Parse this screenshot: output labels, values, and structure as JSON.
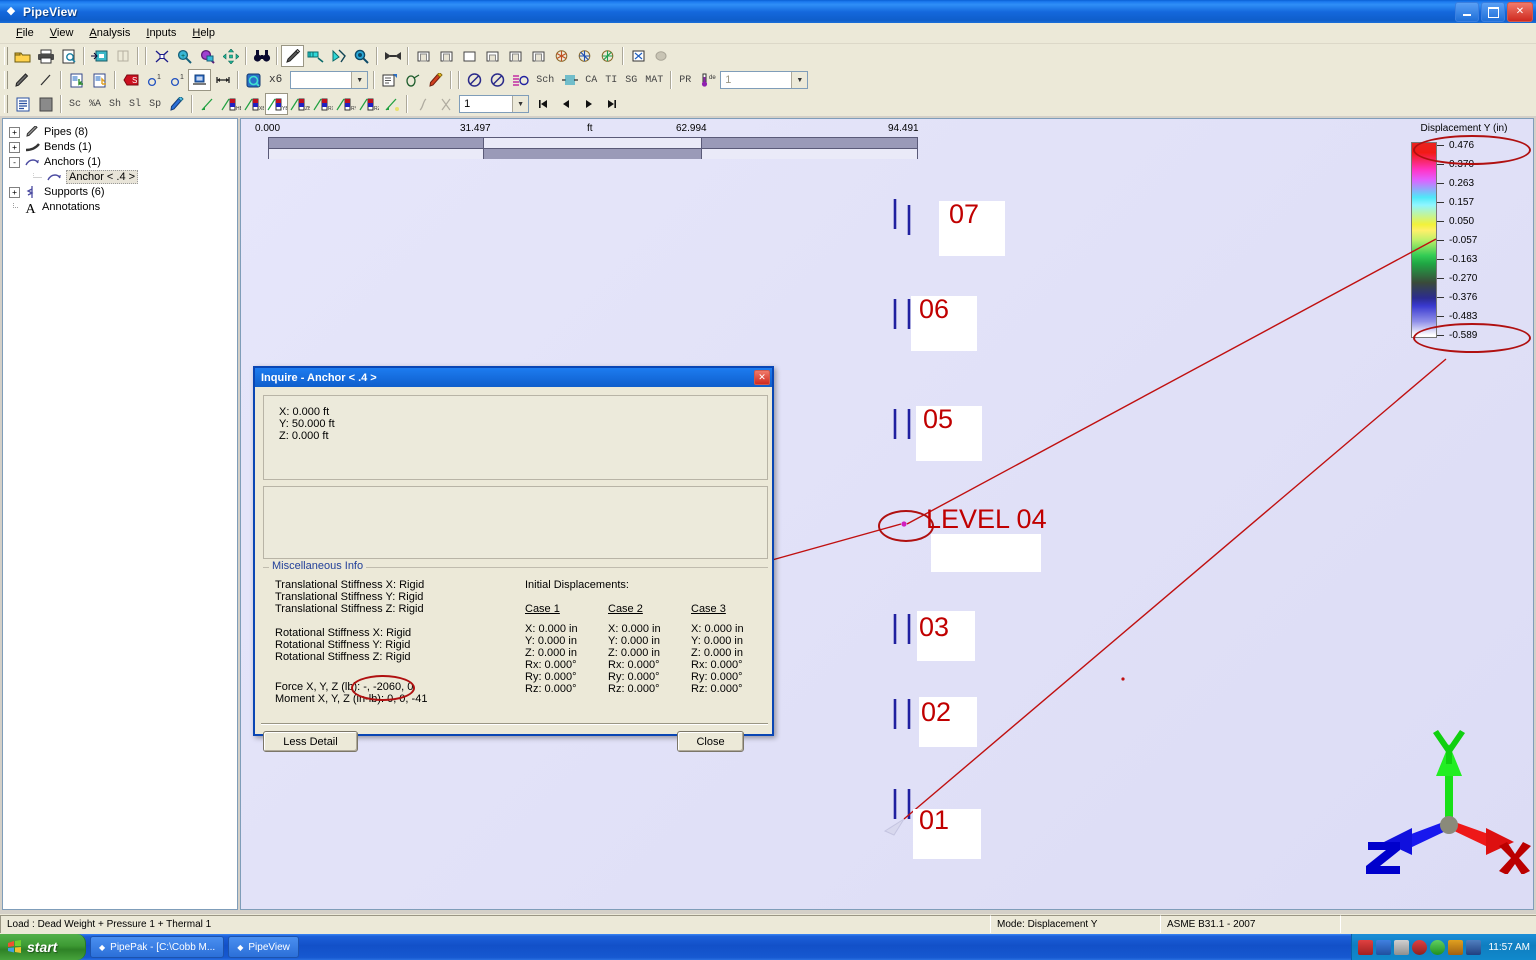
{
  "window": {
    "title": "PipeView",
    "icon": "diamond-icon",
    "buttons": {
      "minimize": "–",
      "maximize": "❐",
      "close": "✕"
    }
  },
  "menu": {
    "items": [
      {
        "label": "File",
        "name": "menu-file"
      },
      {
        "label": "View",
        "name": "menu-view"
      },
      {
        "label": "Analysis",
        "name": "menu-analysis"
      },
      {
        "label": "Inputs",
        "name": "menu-inputs"
      },
      {
        "label": "Help",
        "name": "menu-help"
      }
    ]
  },
  "toolbar_row3": {
    "labels": [
      "Sc",
      "%A",
      "Sh",
      "Sl",
      "Sp"
    ],
    "stress_codes": [
      "HB",
      "XB",
      "YB",
      "ZB",
      "RX",
      "RY",
      "RZ"
    ],
    "step_value": "1"
  },
  "toolbar_row2": {
    "zoom_factor": "x6",
    "zoom_combo_value": "",
    "codes": [
      "Sch",
      "CA",
      "TI",
      "SG",
      "MAT",
      "PR"
    ],
    "temp_combo_value": "1"
  },
  "tree": {
    "items": [
      {
        "label": "Pipes (8)",
        "icon": "pipe-icon",
        "expander": "+",
        "level": 0,
        "selected": false
      },
      {
        "label": "Bends (1)",
        "icon": "bend-icon",
        "expander": "+",
        "level": 0,
        "selected": false
      },
      {
        "label": "Anchors (1)",
        "icon": "anchor-icon",
        "expander": "-",
        "level": 0,
        "selected": false
      },
      {
        "label": "Anchor < .4 >",
        "icon": "anchor-icon",
        "expander": "",
        "level": 1,
        "selected": true
      },
      {
        "label": "Supports (6)",
        "icon": "support-icon",
        "expander": "+",
        "level": 0,
        "selected": false
      },
      {
        "label": "Annotations",
        "icon": "text-icon",
        "expander": "",
        "level": 0,
        "selected": false
      }
    ]
  },
  "ruler": {
    "ticks": [
      "0.000",
      "31.497",
      "ft",
      "62.994",
      "94.491"
    ],
    "unit": "ft"
  },
  "legend": {
    "title": "Displacement Y (in)",
    "values": [
      "0.476",
      "0.370",
      "0.263",
      "0.157",
      "0.050",
      "-0.057",
      "-0.163",
      "-0.270",
      "-0.376",
      "-0.483",
      "-0.589"
    ],
    "max_highlight": "0.476",
    "min_highlight": "-0.589"
  },
  "model": {
    "labels": [
      {
        "text": "07",
        "name": "level-label-07"
      },
      {
        "text": "06",
        "name": "level-label-06"
      },
      {
        "text": "05",
        "name": "level-label-05"
      },
      {
        "text": "LEVEL 04",
        "name": "level-label-04"
      },
      {
        "text": "03",
        "name": "level-label-03"
      },
      {
        "text": "02",
        "name": "level-label-02"
      },
      {
        "text": "01",
        "name": "level-label-01"
      }
    ],
    "axis_labels": {
      "x": "X",
      "y": "Y",
      "z": "Z"
    }
  },
  "dialog": {
    "title": "Inquire - Anchor < .4 >",
    "close_glyph": "✕",
    "coordinates": [
      "X: 0.000 ft",
      "Y: 50.000 ft",
      "Z: 0.000 ft"
    ],
    "misc_legend": "Miscellaneous Info",
    "stiffness": [
      "Translational Stiffness X:  Rigid",
      "Translational Stiffness Y:  Rigid",
      "Translational Stiffness Z:  Rigid",
      "Rotational Stiffness X:  Rigid",
      "Rotational Stiffness Y:  Rigid",
      "Rotational Stiffness Z:  Rigid"
    ],
    "force_line": "Force X, Y, Z (lb): -,  -2060, 0",
    "moment_line": "Moment X, Y, Z (in-lb): 0, 0, -41",
    "initial_displacements_title": "Initial Displacements:",
    "cases": [
      {
        "header": "Case 1",
        "rows": [
          "X: 0.000 in",
          "Y: 0.000 in",
          "Z: 0.000 in",
          "Rx: 0.000°",
          "Ry: 0.000°",
          "Rz: 0.000°"
        ]
      },
      {
        "header": "Case 2",
        "rows": [
          "X: 0.000 in",
          "Y: 0.000 in",
          "Z: 0.000 in",
          "Rx: 0.000°",
          "Ry: 0.000°",
          "Rz: 0.000°"
        ]
      },
      {
        "header": "Case 3",
        "rows": [
          "X: 0.000 in",
          "Y: 0.000 in",
          "Z: 0.000 in",
          "Rx: 0.000°",
          "Ry: 0.000°",
          "Rz: 0.000°"
        ]
      }
    ],
    "less_detail_label": "Less Detail",
    "close_label": "Close"
  },
  "statusbar": {
    "load": "Load : Dead Weight + Pressure 1 + Thermal 1",
    "mode": "Mode: Displacement Y",
    "code": "ASME B31.1 - 2007"
  },
  "taskbar": {
    "start": "start",
    "tasks": [
      {
        "label": "PipePak - [C:\\Cobb M...",
        "name": "taskbar-item-pipepak"
      },
      {
        "label": "PipeView",
        "name": "taskbar-item-pipeview"
      }
    ],
    "clock": "11:57 AM"
  },
  "colors": {
    "title_blue": "#1d7cf0",
    "accent_red": "#c00000",
    "annotation_red": "#b01010",
    "toolbar_bg": "#ece9d8",
    "viewport_bg": "#e6e6fa"
  }
}
